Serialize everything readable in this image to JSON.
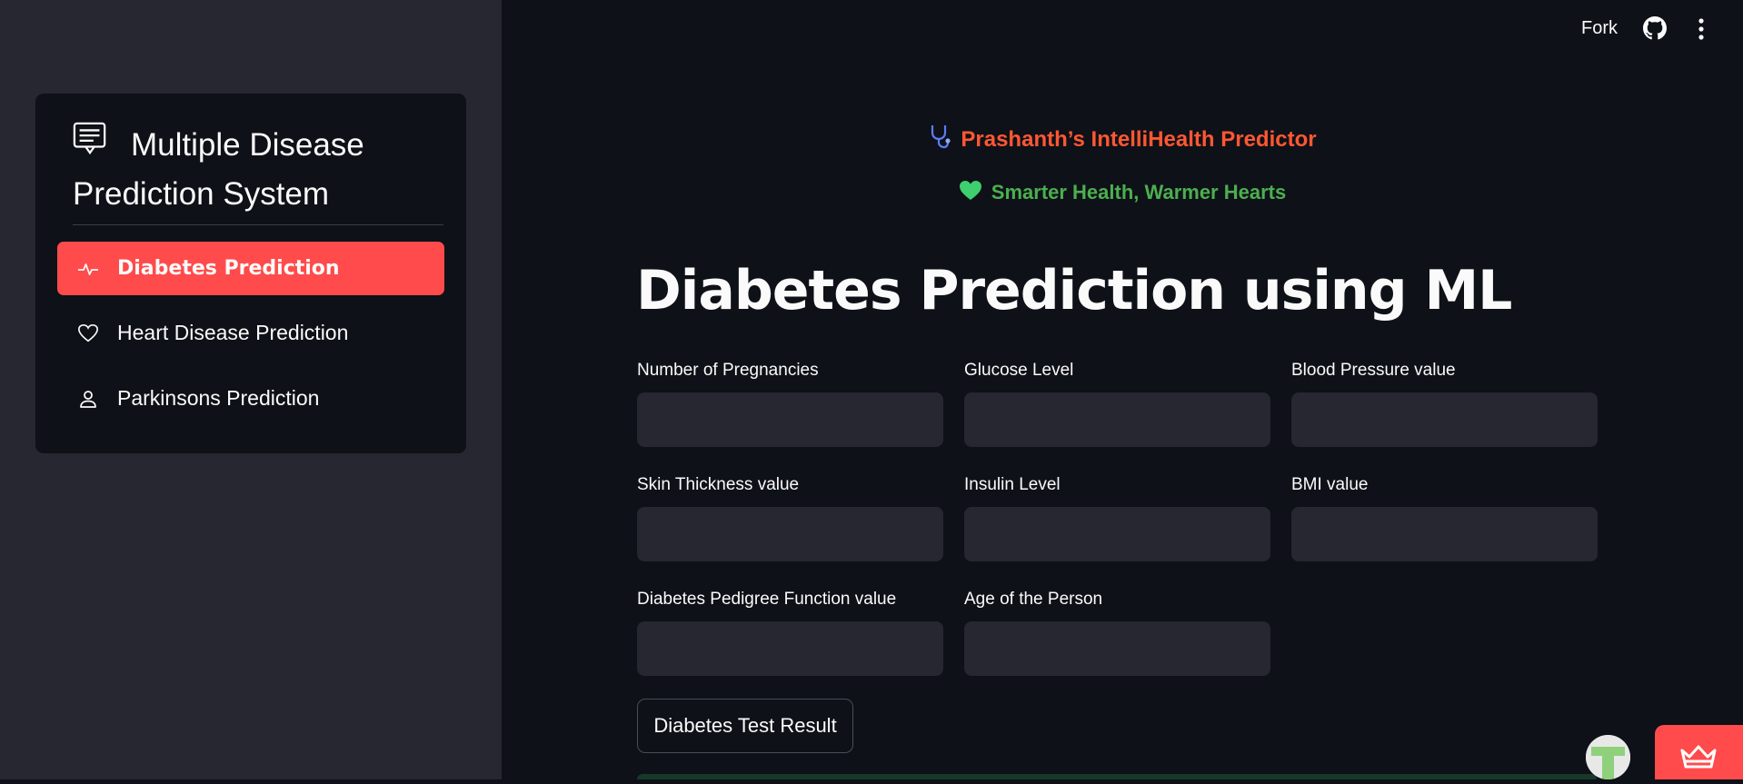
{
  "sidebar": {
    "title": "Multiple Disease Prediction System",
    "items": [
      {
        "label": "Diabetes Prediction",
        "icon": "activity-icon",
        "active": true
      },
      {
        "label": "Heart Disease Prediction",
        "icon": "heart-icon",
        "active": false
      },
      {
        "label": "Parkinsons Prediction",
        "icon": "person-icon",
        "active": false
      }
    ]
  },
  "header": {
    "fork_label": "Fork",
    "github_icon": "github-icon",
    "menu_icon": "kebab-menu-icon"
  },
  "brand": {
    "name": "Prashanth’s IntelliHealth Predictor",
    "tagline": "Smarter Health, Warmer Hearts",
    "name_color": "#ff5733",
    "tagline_color": "#4caf50"
  },
  "main": {
    "title": "Diabetes Prediction using ML",
    "fields": [
      {
        "label": "Number of Pregnancies",
        "value": ""
      },
      {
        "label": "Glucose Level",
        "value": ""
      },
      {
        "label": "Blood Pressure value",
        "value": ""
      },
      {
        "label": "Skin Thickness value",
        "value": ""
      },
      {
        "label": "Insulin Level",
        "value": ""
      },
      {
        "label": "BMI value",
        "value": ""
      },
      {
        "label": "Diabetes Pedigree Function value",
        "value": ""
      },
      {
        "label": "Age of the Person",
        "value": ""
      }
    ],
    "button_label": "Diabetes Test Result"
  },
  "colors": {
    "accent": "#ff4b4b",
    "background": "#0e1117",
    "sidebar": "#262730"
  }
}
